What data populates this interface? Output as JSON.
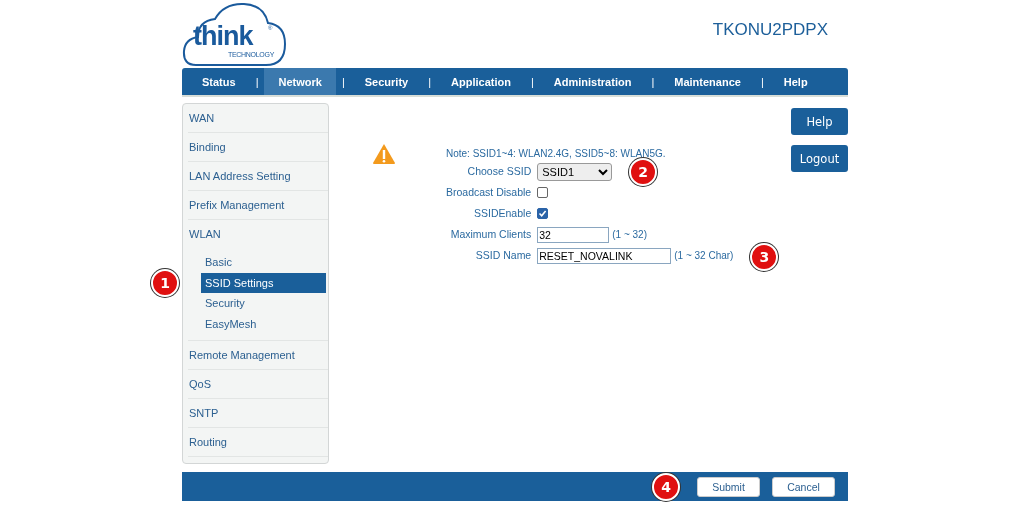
{
  "logo": {
    "word": "think",
    "tagline": "TECHNOLOGY",
    "mark": "®"
  },
  "device_name": "TKONU2PDPX",
  "nav": {
    "separator": "|",
    "items": [
      {
        "label": "Status",
        "selected": false
      },
      {
        "label": "Network",
        "selected": true
      },
      {
        "label": "Security",
        "selected": false
      },
      {
        "label": "Application",
        "selected": false
      },
      {
        "label": "Administration",
        "selected": false
      },
      {
        "label": "Maintenance",
        "selected": false
      },
      {
        "label": "Help",
        "selected": false
      }
    ]
  },
  "sidebar": {
    "items": [
      {
        "label": "WAN",
        "selected": false
      },
      {
        "label": "Binding",
        "selected": false
      },
      {
        "label": "LAN Address Setting",
        "selected": false
      },
      {
        "label": "Prefix Management",
        "selected": false
      },
      {
        "label": "WLAN",
        "selected": false,
        "children": [
          {
            "label": "Basic",
            "selected": false
          },
          {
            "label": "SSID Settings",
            "selected": true,
            "annotation": "1"
          },
          {
            "label": "Security",
            "selected": false
          },
          {
            "label": "EasyMesh",
            "selected": false
          }
        ]
      },
      {
        "label": "Remote Management",
        "selected": false
      },
      {
        "label": "QoS",
        "selected": false
      },
      {
        "label": "SNTP",
        "selected": false
      },
      {
        "label": "Routing",
        "selected": false
      }
    ]
  },
  "form": {
    "note": "Note: SSID1~4: WLAN2.4G, SSID5~8: WLAN5G.",
    "fields": [
      {
        "kind": "select",
        "label": "Choose SSID",
        "value": "SSID1",
        "annotation": "2"
      },
      {
        "kind": "checkbox",
        "label": "Broadcast Disable",
        "checked": false
      },
      {
        "kind": "checkbox",
        "label": "SSIDEnable",
        "checked": true
      },
      {
        "kind": "short_text",
        "label": "Maximum Clients",
        "value": "32",
        "hint": "(1 ~ 32)"
      },
      {
        "kind": "long_text",
        "label": "SSID Name",
        "value": "RESET_NOVALINK",
        "hint": "(1 ~ 32 Char)",
        "annotation": "3"
      }
    ]
  },
  "side_buttons": [
    "Help",
    "Logout"
  ],
  "footer": {
    "annotation": "4",
    "buttons": [
      "Submit",
      "Cancel"
    ]
  }
}
